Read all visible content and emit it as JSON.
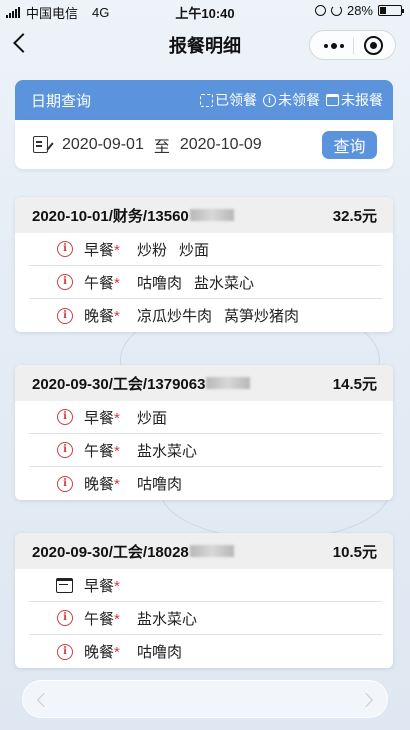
{
  "status": {
    "carrier": "中国电信",
    "network": "4G",
    "time": "上午10:40",
    "battery": "28%"
  },
  "nav": {
    "title": "报餐明细"
  },
  "query": {
    "label": "日期查询",
    "legend": {
      "received": "已领餐",
      "not_received": "未领餐",
      "not_ordered": "未报餐"
    },
    "start_date": "2020-09-01",
    "to_label": "至",
    "end_date": "2020-10-09",
    "button": "查询"
  },
  "records": [
    {
      "title": "2020-10-01/财务/13560",
      "amount": "32.5元",
      "meals": [
        {
          "name": "早餐",
          "status": "not_received",
          "dishes": [
            "炒粉",
            "炒面"
          ]
        },
        {
          "name": "午餐",
          "status": "not_received",
          "dishes": [
            "咕噜肉",
            "盐水菜心"
          ]
        },
        {
          "name": "晚餐",
          "status": "not_received",
          "dishes": [
            "凉瓜炒牛肉",
            "莴笋炒猪肉"
          ]
        }
      ]
    },
    {
      "title": "2020-09-30/工会/1379063",
      "amount": "14.5元",
      "meals": [
        {
          "name": "早餐",
          "status": "not_received",
          "dishes": [
            "炒面"
          ]
        },
        {
          "name": "午餐",
          "status": "not_received",
          "dishes": [
            "盐水菜心"
          ]
        },
        {
          "name": "晚餐",
          "status": "not_received",
          "dishes": [
            "咕噜肉"
          ]
        }
      ]
    },
    {
      "title": "2020-09-30/工会/18028",
      "amount": "10.5元",
      "meals": [
        {
          "name": "早餐",
          "status": "not_ordered",
          "dishes": []
        },
        {
          "name": "午餐",
          "status": "not_received",
          "dishes": [
            "盐水菜心"
          ]
        },
        {
          "name": "晚餐",
          "status": "not_received",
          "dishes": [
            "咕噜肉"
          ]
        }
      ]
    }
  ],
  "colors": {
    "accent": "#5b94dc",
    "alert": "#d23c3c",
    "card_header": "#efefef"
  }
}
